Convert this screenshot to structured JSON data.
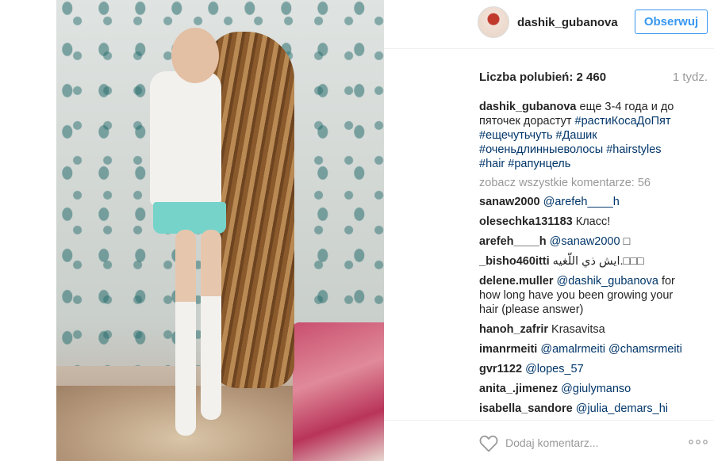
{
  "post": {
    "username": "dashik_gubanova",
    "follow_label": "Obserwuj",
    "likes_label": "Liczba polubień: 2 460",
    "time_label": "1 tydz.",
    "caption": {
      "username": "dashik_gubanova",
      "text_1": " еще 3-4 года и до пяточек дорастут ",
      "tag_1": "#растиКосаДоПят",
      "tag_2": "#ещечутьчуть",
      "tag_3": "#Дашик",
      "tag_4": "#оченьдлинныеволосы",
      "tag_5": "#hairstyles",
      "tag_6": "#hair",
      "tag_7": "#рапунцель"
    },
    "view_all_label": "zobacz wszystkie komentarze: 56",
    "comments": [
      {
        "user": "sanaw2000",
        "mention": "@arefeh____h",
        "text": ""
      },
      {
        "user": "olesechka131183",
        "mention": "",
        "text": "Класс!"
      },
      {
        "user": "arefeh____h",
        "mention": "@sanaw2000",
        "text": " □"
      },
      {
        "user": "_bisho460itti",
        "mention": "",
        "text": "ايش ذي اللّغيه.□□□"
      },
      {
        "user": "delene.muller",
        "mention": "@dashik_gubanova",
        "text": " for how long have you been growing your hair (please answer)"
      },
      {
        "user": "hanoh_zafrir",
        "mention": "",
        "text": "Krasavitsa"
      },
      {
        "user": "imanrmeiti",
        "mention": "@amalrmeiti @chamsrmeiti",
        "text": ""
      },
      {
        "user": "gvr1122",
        "mention": "@lopes_57",
        "text": ""
      },
      {
        "user": "anita_.jimenez",
        "mention": "@giulymanso",
        "text": ""
      },
      {
        "user": "isabella_sandore",
        "mention": "@julia_demars_hi",
        "text": ""
      }
    ],
    "add_comment_placeholder": "Dodaj komentarz..."
  },
  "icons": {
    "like": "heart-outline-icon",
    "more": "more-dots-icon"
  },
  "colors": {
    "accent": "#3897f0",
    "link": "#003569",
    "muted": "#999999",
    "text": "#262626"
  }
}
